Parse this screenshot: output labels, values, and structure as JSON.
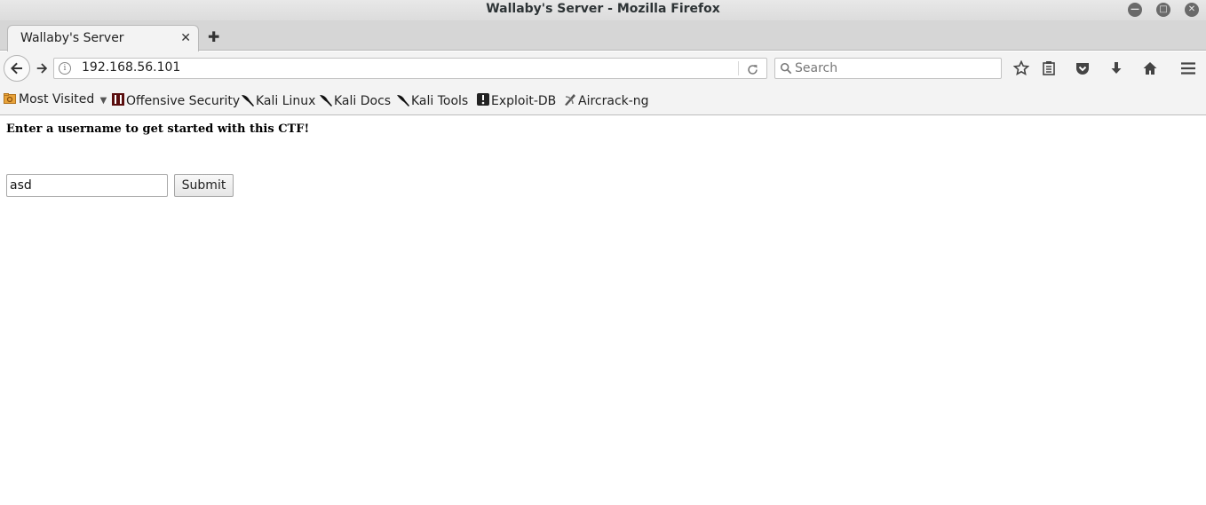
{
  "window": {
    "title": "Wallaby's Server - Mozilla Firefox"
  },
  "tabs": [
    {
      "label": "Wallaby's Server",
      "close_glyph": "✕"
    }
  ],
  "newtab_glyph": "✚",
  "navbar": {
    "url": "192.168.56.101",
    "search_placeholder": "Search",
    "icons": [
      "back-icon",
      "forward-icon",
      "info-icon",
      "reload-icon",
      "bookmark-star-icon",
      "reading-list-icon",
      "pocket-icon",
      "download-icon",
      "home-icon",
      "menu-icon"
    ]
  },
  "bookmarks": {
    "items": [
      {
        "label": "Most Visited",
        "icon": "folder-icon"
      },
      {
        "label": "Offensive Security",
        "icon": "offsec-icon"
      },
      {
        "label": "Kali Linux",
        "icon": "kali-icon"
      },
      {
        "label": "Kali Docs",
        "icon": "kali-icon"
      },
      {
        "label": "Kali Tools",
        "icon": "kali-icon"
      },
      {
        "label": "Exploit-DB",
        "icon": "exploitdb-icon"
      },
      {
        "label": "Aircrack-ng",
        "icon": "aircrack-icon"
      }
    ]
  },
  "page": {
    "heading": "Enter a username to get started with this CTF!",
    "username_value": "asd",
    "submit_label": "Submit"
  }
}
